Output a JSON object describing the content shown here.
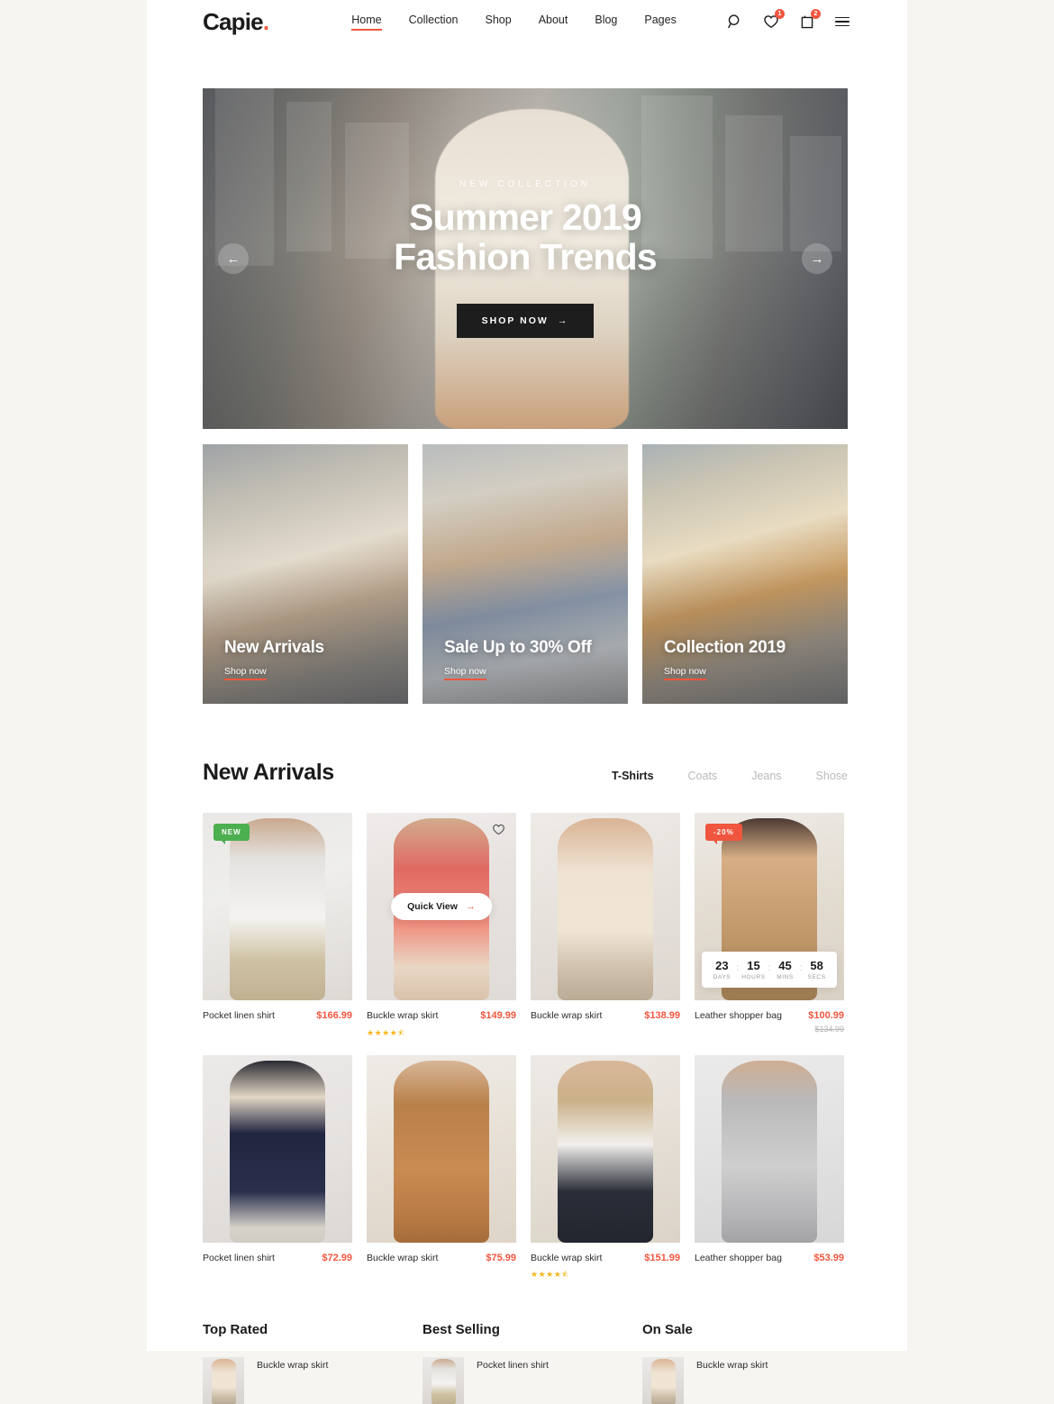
{
  "header": {
    "logo": "Capie",
    "logo_dot": ".",
    "nav": [
      {
        "label": "Home",
        "active": true
      },
      {
        "label": "Collection",
        "active": false
      },
      {
        "label": "Shop",
        "active": false
      },
      {
        "label": "About",
        "active": false
      },
      {
        "label": "Blog",
        "active": false
      },
      {
        "label": "Pages",
        "active": false
      }
    ],
    "icons": {
      "search": "search-icon",
      "wishlist": "heart-icon",
      "wishlist_count": "1",
      "cart": "bag-icon",
      "cart_count": "2",
      "menu": "hamburger-icon"
    }
  },
  "hero": {
    "kicker": "NEW COLLECTION",
    "title_line1": "Summer 2019",
    "title_line2": "Fashion Trends",
    "cta": "SHOP NOW",
    "cta_arrow": "→",
    "prev_arrow": "←",
    "next_arrow": "→"
  },
  "promos": [
    {
      "title": "New Arrivals",
      "link": "Shop now"
    },
    {
      "title": "Sale Up to 30% Off",
      "link": "Shop now"
    },
    {
      "title": "Collection 2019",
      "link": "Shop now"
    }
  ],
  "new_arrivals": {
    "title": "New Arrivals",
    "tabs": [
      {
        "label": "T-Shirts",
        "active": true
      },
      {
        "label": "Coats",
        "active": false
      },
      {
        "label": "Jeans",
        "active": false
      },
      {
        "label": "Shose",
        "active": false
      }
    ],
    "products": [
      {
        "name": "Pocket linen shirt",
        "price": "$166.99",
        "old_price": "",
        "badge": "NEW",
        "badge_type": "new",
        "rating": "",
        "wishlist": false,
        "quick_view": "",
        "countdown": null
      },
      {
        "name": "Buckle wrap skirt",
        "price": "$149.99",
        "old_price": "",
        "badge": "",
        "badge_type": "",
        "rating": "★★★★⯪",
        "wishlist": true,
        "quick_view": "Quick View",
        "countdown": null
      },
      {
        "name": "Buckle wrap skirt",
        "price": "$138.99",
        "old_price": "",
        "badge": "",
        "badge_type": "",
        "rating": "",
        "wishlist": false,
        "quick_view": "",
        "countdown": null
      },
      {
        "name": "Leather shopper bag",
        "price": "$100.99",
        "old_price": "$134.99",
        "badge": "-20%",
        "badge_type": "sale",
        "rating": "",
        "wishlist": false,
        "quick_view": "",
        "countdown": {
          "days": "23",
          "days_label": "DAYS",
          "hours": "15",
          "hours_label": "HOURS",
          "mins": "45",
          "mins_label": "MINS",
          "secs": "58",
          "secs_label": "SECS",
          "separator": ":"
        }
      },
      {
        "name": "Pocket linen shirt",
        "price": "$72.99",
        "old_price": "",
        "badge": "",
        "badge_type": "",
        "rating": "",
        "wishlist": false,
        "quick_view": "",
        "countdown": null
      },
      {
        "name": "Buckle wrap skirt",
        "price": "$75.99",
        "old_price": "",
        "badge": "",
        "badge_type": "",
        "rating": "",
        "wishlist": false,
        "quick_view": "",
        "countdown": null
      },
      {
        "name": "Buckle wrap skirt",
        "price": "$151.99",
        "old_price": "",
        "badge": "",
        "badge_type": "",
        "rating": "★★★★⯪",
        "wishlist": false,
        "quick_view": "",
        "countdown": null
      },
      {
        "name": "Leather shopper bag",
        "price": "$53.99",
        "old_price": "",
        "badge": "",
        "badge_type": "",
        "rating": "",
        "wishlist": false,
        "quick_view": "",
        "countdown": null
      }
    ]
  },
  "bottom_lists": [
    {
      "title": "Top Rated",
      "items": [
        {
          "name": "Buckle wrap skirt"
        }
      ]
    },
    {
      "title": "Best Selling",
      "items": [
        {
          "name": "Pocket linen shirt"
        }
      ]
    },
    {
      "title": "On Sale",
      "items": [
        {
          "name": "Buckle wrap skirt"
        }
      ]
    }
  ],
  "colors": {
    "accent": "#f0563f",
    "text": "#1b1b1b",
    "muted": "#b9b9b9",
    "new_badge": "#4caf50",
    "star": "#f5b719",
    "page_bg": "#f6f5f1"
  }
}
